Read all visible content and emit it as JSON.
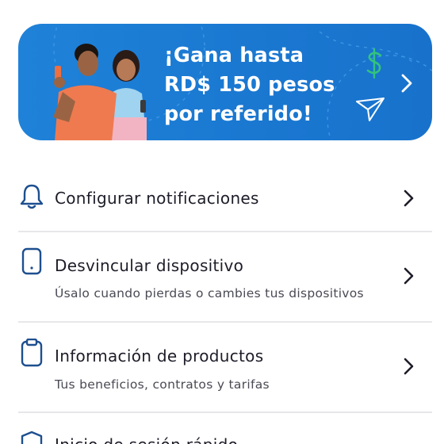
{
  "banner": {
    "line1": "¡Gana hasta",
    "line2": "RD$ 150 pesos",
    "line3": "por referido!",
    "background": "#1a78d1",
    "accent_green": "#33c27f"
  },
  "menu": {
    "items": [
      {
        "title": "Configurar notificaciones",
        "subtitle": "",
        "icon": "bell-icon"
      },
      {
        "title": "Desvincular dispositivo",
        "subtitle": "Úsalo cuando pierdas o cambies tus dispositivos",
        "icon": "phone-icon"
      },
      {
        "title": "Información de productos",
        "subtitle": "Tus beneficios, contratos y tarifas",
        "icon": "clipboard-icon"
      },
      {
        "title": "Inicio de sesión rápido",
        "subtitle": "",
        "icon": "shield-icon"
      }
    ],
    "icon_color": "#1d4f8f"
  }
}
